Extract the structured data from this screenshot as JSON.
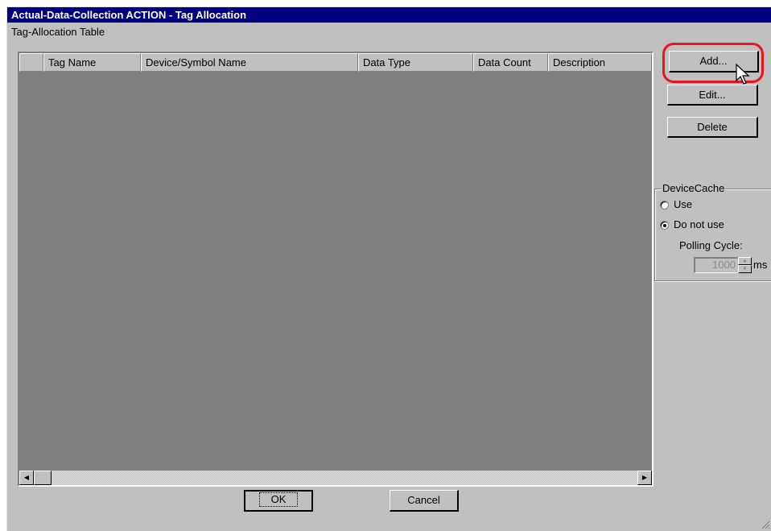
{
  "window": {
    "title": "Actual-Data-Collection ACTION - Tag Allocation"
  },
  "table": {
    "label": "Tag-Allocation Table",
    "columns": [
      "",
      "Tag Name",
      "Device/Symbol Name",
      "Data Type",
      "Data Count",
      "Description"
    ],
    "rows": []
  },
  "buttons": {
    "add": "Add...",
    "edit": "Edit...",
    "delete": "Delete",
    "ok": "OK",
    "cancel": "Cancel"
  },
  "device_cache": {
    "label": "DeviceCache",
    "options": [
      "Use",
      "Do not use"
    ],
    "selected": "Do not use",
    "polling_label": "Polling Cycle:",
    "polling_value": "1000",
    "polling_unit": "ms"
  },
  "colors": {
    "titlebar": "#000080",
    "highlight": "#e8141e",
    "dialog": "#c0c0c0",
    "table_body": "#808080"
  },
  "icons": [
    "scroll-left-icon",
    "scroll-right-icon",
    "mouse-pointer-icon",
    "spin-up-icon",
    "spin-down-icon",
    "resize-grip-icon"
  ]
}
